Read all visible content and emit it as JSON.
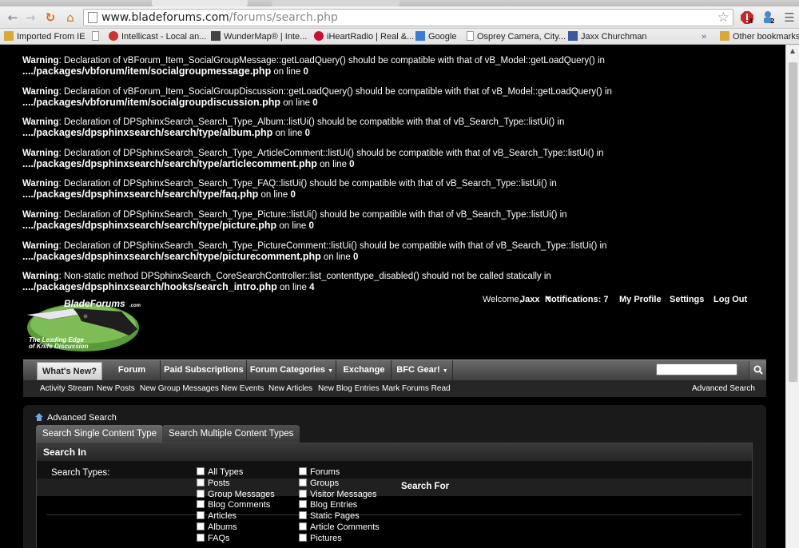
{
  "browser": {
    "url_host": "www.bladeforums.com",
    "url_path": "/forums/search.php",
    "ext_badge_1": "4",
    "ext_badge_2": "2"
  },
  "bookmarks": {
    "items": [
      "Imported From IE",
      "Intellicast - Local an...",
      "WunderMap® | Inte...",
      "iHeartRadio | Real &...",
      "Google",
      "Osprey Camera, City...",
      "Jaxx Churchman"
    ],
    "overflow": "»",
    "other": "Other bookmarks"
  },
  "warnings": [
    {
      "label": "Warning",
      "msg": ": Declaration of vBForum_Item_SocialGroupMessage::getLoadQuery() should be compatible with that of vB_Model::getLoadQuery() in",
      "path": "..../packages/vbforum/item/socialgroupmessage.php",
      "online": " on line ",
      "line": "0"
    },
    {
      "label": "Warning",
      "msg": ": Declaration of vBForum_Item_SocialGroupDiscussion::getLoadQuery() should be compatible with that of vB_Model::getLoadQuery() in",
      "path": "..../packages/vbforum/item/socialgroupdiscussion.php",
      "online": " on line ",
      "line": "0"
    },
    {
      "label": "Warning",
      "msg": ": Declaration of DPSphinxSearch_Search_Type_Album::listUi() should be compatible with that of vB_Search_Type::listUi() in",
      "path": "..../packages/dpsphinxsearch/search/type/album.php",
      "online": " on line ",
      "line": "0"
    },
    {
      "label": "Warning",
      "msg": ": Declaration of DPSphinxSearch_Search_Type_ArticleComment::listUi() should be compatible with that of vB_Search_Type::listUi() in",
      "path": "..../packages/dpsphinxsearch/search/type/articlecomment.php",
      "online": " on line ",
      "line": "0"
    },
    {
      "label": "Warning",
      "msg": ": Declaration of DPSphinxSearch_Search_Type_FAQ::listUi() should be compatible with that of vB_Search_Type::listUi() in",
      "path": "..../packages/dpsphinxsearch/search/type/faq.php",
      "online": " on line ",
      "line": "0"
    },
    {
      "label": "Warning",
      "msg": ": Declaration of DPSphinxSearch_Search_Type_Picture::listUi() should be compatible with that of vB_Search_Type::listUi() in",
      "path": "..../packages/dpsphinxsearch/search/type/picture.php",
      "online": " on line ",
      "line": "0"
    },
    {
      "label": "Warning",
      "msg": ": Declaration of DPSphinxSearch_Search_Type_PictureComment::listUi() should be compatible with that of vB_Search_Type::listUi() in",
      "path": "..../packages/dpsphinxsearch/search/type/picturecomment.php",
      "online": " on line ",
      "line": "0"
    },
    {
      "label": "Warning",
      "msg": ": Non-static method DPSphinxSearch_CoreSearchController::list_contenttype_disabled() should not be called statically in",
      "path": "..../packages/dpsphinxsearch/hooks/search_intro.php",
      "online": " on line ",
      "line": "4"
    }
  ],
  "logo": {
    "name": "BladeForums",
    "suffix": ".com",
    "tagline1": "The Leading Edge",
    "tagline2": "of Knife Discussion"
  },
  "header": {
    "welcome": "Welcome,",
    "user": "Jaxx",
    "notifications": "Notifications: 7",
    "my_profile": "My Profile",
    "settings": "Settings",
    "logout": "Log Out"
  },
  "navtabs": [
    "What's New?",
    "Forum",
    "Paid Subscriptions",
    "Forum Categories",
    "Exchange",
    "BFC Gear!"
  ],
  "subnav": [
    "Activity Stream",
    "New Posts",
    "New Group Messages",
    "New Events",
    "New Articles",
    "New Blog Entries",
    "Mark Forums Read"
  ],
  "subnav_right": "Advanced Search",
  "breadcrumb": "Advanced Search",
  "content_tabs": [
    "Search Single Content Type",
    "Search Multiple Content Types"
  ],
  "form": {
    "section_title": "Search In",
    "types_label": "Search Types:",
    "search_for": "Search For",
    "col1": [
      "All Types",
      "Posts",
      "Group Messages",
      "Blog Comments",
      "Articles",
      "Albums",
      "FAQs"
    ],
    "col2": [
      "Forums",
      "Groups",
      "Visitor Messages",
      "Blog Entries",
      "Static Pages",
      "Article Comments",
      "Pictures"
    ]
  }
}
